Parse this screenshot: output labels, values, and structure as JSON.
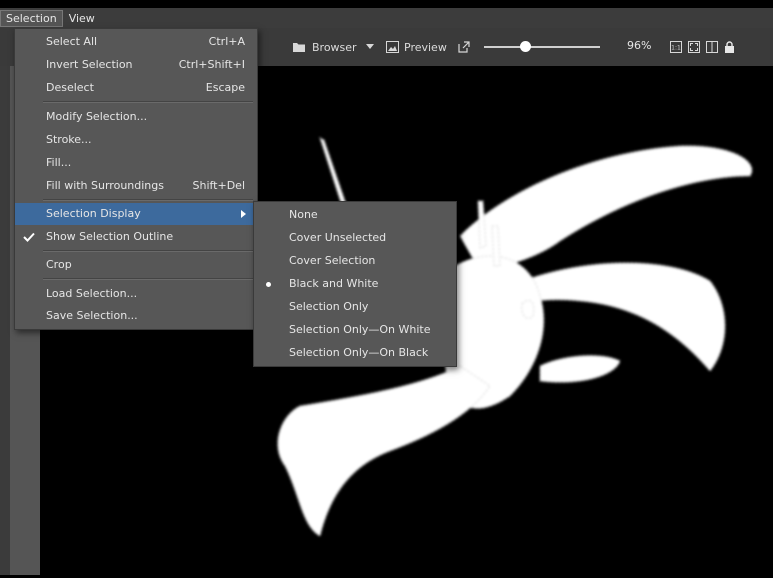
{
  "menubar": {
    "items": [
      {
        "label": "Selection",
        "active": true
      },
      {
        "label": "View",
        "active": false
      }
    ]
  },
  "toolbar": {
    "browser_label": "Browser",
    "preview_label": "Preview",
    "zoom_label": "96%",
    "zoom_fraction": 0.35
  },
  "selection_menu": {
    "items": [
      {
        "label": "Select All",
        "shortcut": "Ctrl+A"
      },
      {
        "label": "Invert Selection",
        "shortcut": "Ctrl+Shift+I"
      },
      {
        "label": "Deselect",
        "shortcut": "Escape"
      },
      {
        "label": "Modify Selection...",
        "shortcut": ""
      },
      {
        "label": "Stroke...",
        "shortcut": ""
      },
      {
        "label": "Fill...",
        "shortcut": ""
      },
      {
        "label": "Fill with Surroundings",
        "shortcut": "Shift+Del"
      },
      {
        "label": "Selection Display",
        "shortcut": ""
      },
      {
        "label": "Show Selection Outline",
        "shortcut": ""
      },
      {
        "label": "Crop",
        "shortcut": ""
      },
      {
        "label": "Load Selection...",
        "shortcut": ""
      },
      {
        "label": "Save Selection...",
        "shortcut": ""
      }
    ]
  },
  "display_submenu": {
    "items": [
      {
        "label": "None",
        "selected": false
      },
      {
        "label": "Cover Unselected",
        "selected": false
      },
      {
        "label": "Cover Selection",
        "selected": false
      },
      {
        "label": "Black and White",
        "selected": true
      },
      {
        "label": "Selection Only",
        "selected": false
      },
      {
        "label": "Selection Only—On White",
        "selected": false
      },
      {
        "label": "Selection Only—On Black",
        "selected": false
      }
    ]
  },
  "colors": {
    "menu_bg": "#575757",
    "highlight": "#3d6a9d",
    "toolbar_bg": "#3a3a3a",
    "canvas_bg": "#000000"
  }
}
